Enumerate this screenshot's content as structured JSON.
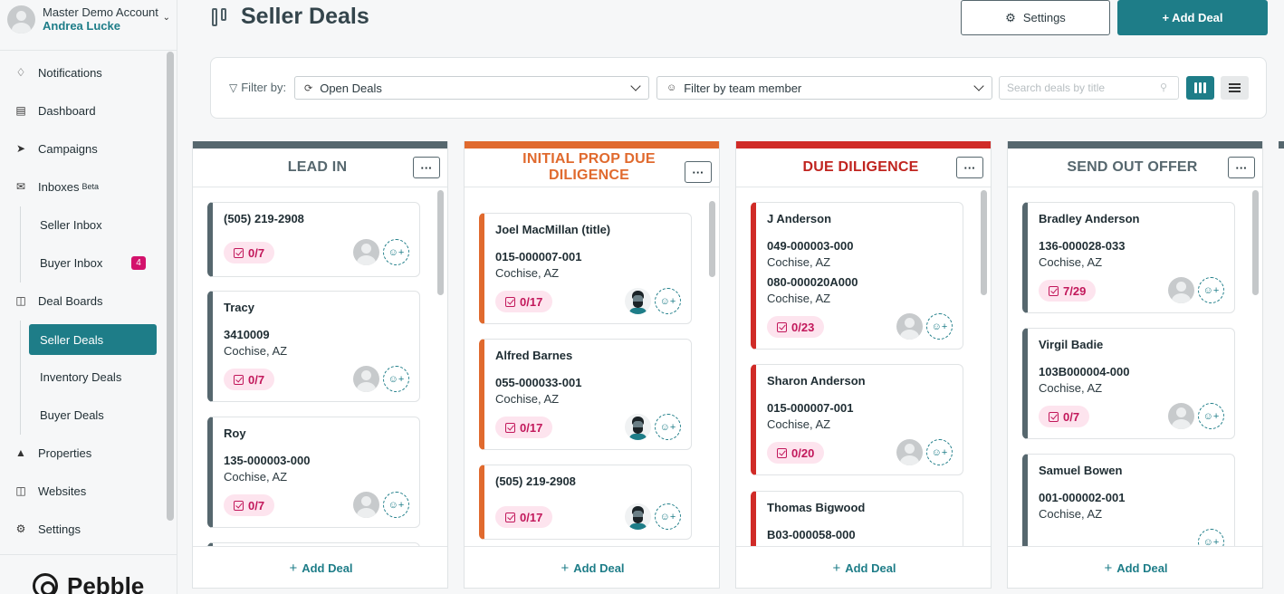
{
  "account": {
    "name": "Master Demo Account",
    "user": "Andrea Lucke"
  },
  "nav": {
    "notifications": "Notifications",
    "dashboard": "Dashboard",
    "campaigns": "Campaigns",
    "inboxes": "Inboxes",
    "inboxes_tag": "Beta",
    "seller_inbox": "Seller Inbox",
    "buyer_inbox": "Buyer Inbox",
    "buyer_inbox_count": "4",
    "deal_boards": "Deal Boards",
    "seller_deals": "Seller Deals",
    "inventory_deals": "Inventory Deals",
    "buyer_deals": "Buyer Deals",
    "properties": "Properties",
    "websites": "Websites",
    "settings": "Settings"
  },
  "logo": "Pebble",
  "header": {
    "title": "Seller Deals",
    "settings_label": "Settings",
    "add_deal_label": "+ Add Deal"
  },
  "filters": {
    "label": "Filter by:",
    "status_value": "Open Deals",
    "member_placeholder": "Filter by team member",
    "search_placeholder": "Search deals by title"
  },
  "colors": {
    "accent": "#1e7d88",
    "lead_in": "#56676e",
    "initial_prop": "#e06a2e",
    "due_diligence": "#d02b27",
    "send_out_offer": "#56676e"
  },
  "columns": [
    {
      "title": "LEAD IN",
      "add_label": "Add Deal",
      "cards": [
        {
          "name": "(505) 219-2908",
          "progress": "0/7"
        },
        {
          "name": "Tracy",
          "apn": "3410009",
          "location": "Cochise, AZ",
          "progress": "0/7"
        },
        {
          "name": "Roy",
          "apn": "135-000003-000",
          "location": "Cochise, AZ",
          "progress": "0/7"
        }
      ]
    },
    {
      "title": "INITIAL PROP DUE DILIGENCE",
      "add_label": "Add Deal",
      "cards": [
        {
          "name": "Joel MacMillan (title)",
          "apn": "015-000007-001",
          "location": "Cochise, AZ",
          "progress": "0/17"
        },
        {
          "name": "Alfred Barnes",
          "apn": "055-000033-001",
          "location": "Cochise, AZ",
          "progress": "0/17"
        },
        {
          "name": "(505) 219-2908",
          "progress": "0/17"
        }
      ]
    },
    {
      "title": "DUE DILIGENCE",
      "add_label": "Add Deal",
      "cards": [
        {
          "name": "J Anderson",
          "apn": "049-000003-000",
          "location": "Cochise, AZ",
          "apn2": "080-000020A000",
          "location2": "Cochise, AZ",
          "progress": "0/23"
        },
        {
          "name": "Sharon Anderson",
          "apn": "015-000007-001",
          "location": "Cochise, AZ",
          "progress": "0/20"
        },
        {
          "name": "Thomas Bigwood",
          "apn": "B03-000058-000"
        }
      ]
    },
    {
      "title": "SEND OUT OFFER",
      "add_label": "Add Deal",
      "cards": [
        {
          "name": "Bradley Anderson",
          "apn": "136-000028-033",
          "location": "Cochise, AZ",
          "progress": "7/29"
        },
        {
          "name": "Virgil Badie",
          "apn": "103B000004-000",
          "location": "Cochise, AZ",
          "progress": "0/7"
        },
        {
          "name": "Samuel Bowen",
          "apn": "001-000002-001",
          "location": "Cochise, AZ"
        }
      ]
    }
  ]
}
